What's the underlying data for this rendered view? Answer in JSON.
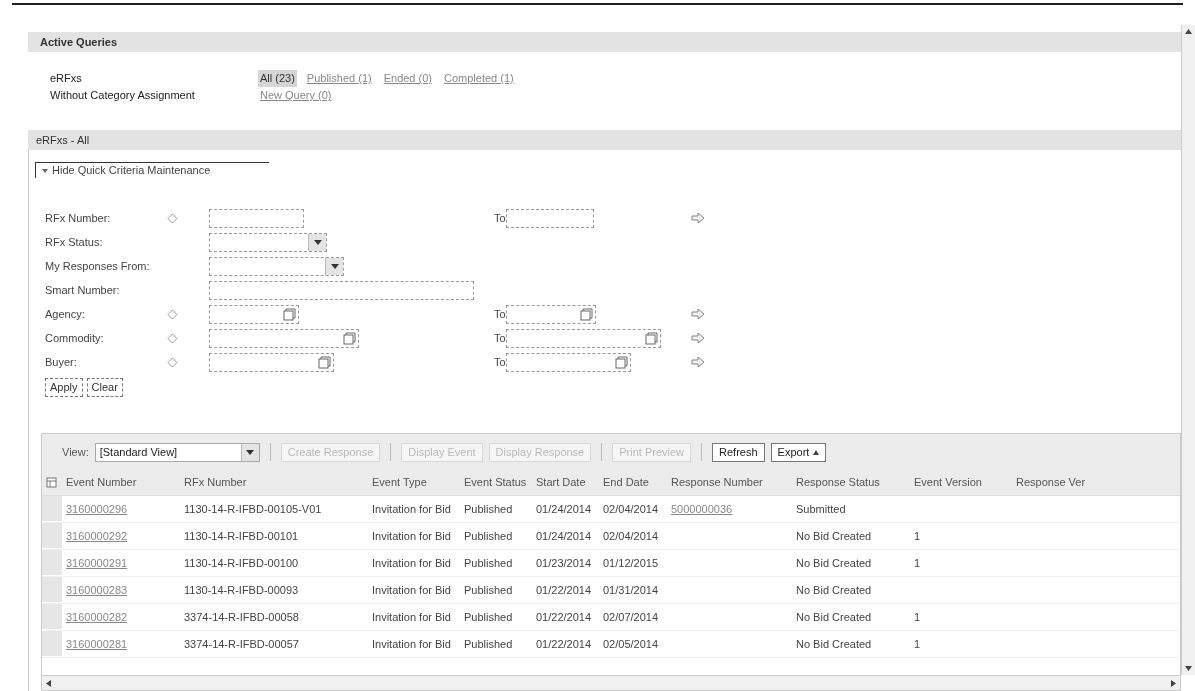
{
  "active_queries": {
    "title": "Active Queries",
    "rows": [
      {
        "label": "eRFxs",
        "links": [
          {
            "label": "All (23)",
            "selected": true
          },
          {
            "label": "Published (1)",
            "selected": false
          },
          {
            "label": "Ended (0)",
            "selected": false
          },
          {
            "label": "Completed (1)",
            "selected": false
          }
        ]
      },
      {
        "label": "Without Category Assignment",
        "links": [
          {
            "label": "New Query (0)",
            "selected": false
          }
        ]
      }
    ]
  },
  "results": {
    "title": "eRFxs - All",
    "toggle": "Hide Quick Criteria Maintenance",
    "criteria": [
      {
        "label": "RFx Number:",
        "kind": "range",
        "to": "To"
      },
      {
        "label": "RFx Status:",
        "kind": "select"
      },
      {
        "label": "My Responses From:",
        "kind": "select"
      },
      {
        "label": "Smart Number:",
        "kind": "text"
      },
      {
        "label": "Agency:",
        "kind": "lookup",
        "to": "To"
      },
      {
        "label": "Commodity:",
        "kind": "lookup",
        "to": "To"
      },
      {
        "label": "Buyer:",
        "kind": "lookup",
        "to": "To"
      }
    ],
    "actions": [
      "Apply",
      "Clear"
    ],
    "toolbar": {
      "view_label": "View:",
      "view_value": "[Standard View]",
      "buttons": [
        {
          "label": "Create Response",
          "disabled": true
        },
        {
          "label": "Display Event",
          "disabled": true
        },
        {
          "label": "Display Response",
          "disabled": true
        },
        {
          "label": "Print Preview",
          "disabled": true
        },
        {
          "label": "Refresh",
          "disabled": false
        },
        {
          "label": "Export",
          "disabled": false,
          "menu": true
        }
      ]
    },
    "table": {
      "columns": [
        "Event Number",
        "RFx Number",
        "Event Type",
        "Event Status",
        "Start Date",
        "End Date",
        "Response Number",
        "Response Status",
        "Event Version",
        "Response Ver"
      ],
      "rows": [
        {
          "event_number": "3160000296",
          "rfx_number": "1130-14-R-IFBD-00105-V01",
          "event_type": "Invitation for Bid",
          "event_status": "Published",
          "start_date": "01/24/2014",
          "end_date": "02/04/2014",
          "response_number": "5000000036",
          "response_status": "Submitted"
        },
        {
          "event_number": "3160000292",
          "rfx_number": "1130-14-R-IFBD-00101",
          "event_type": "Invitation for Bid",
          "event_status": "Published",
          "start_date": "01/24/2014",
          "end_date": "02/04/2014",
          "response_status": "No Bid Created",
          "event_version": "1"
        },
        {
          "event_number": "3160000291",
          "rfx_number": "1130-14-R-IFBD-00100",
          "event_type": "Invitation for Bid",
          "event_status": "Published",
          "start_date": "01/23/2014",
          "end_date": "01/12/2015",
          "response_status": "No Bid Created",
          "event_version": "1"
        },
        {
          "event_number": "3160000283",
          "rfx_number": "1130-14-R-IFBD-00093",
          "event_type": "Invitation for Bid",
          "event_status": "Published",
          "start_date": "01/22/2014",
          "end_date": "01/31/2014",
          "response_status": "No Bid Created"
        },
        {
          "event_number": "3160000282",
          "rfx_number": "3374-14-R-IFBD-00058",
          "event_type": "Invitation for Bid",
          "event_status": "Published",
          "start_date": "01/22/2014",
          "end_date": "02/07/2014",
          "response_status": "No Bid Created",
          "event_version": "1"
        },
        {
          "event_number": "3160000281",
          "rfx_number": "3374-14-R-IFBD-00057",
          "event_type": "Invitation for Bid",
          "event_status": "Published",
          "start_date": "01/22/2014",
          "end_date": "02/05/2014",
          "response_status": "No Bid Created",
          "event_version": "1"
        }
      ]
    }
  }
}
